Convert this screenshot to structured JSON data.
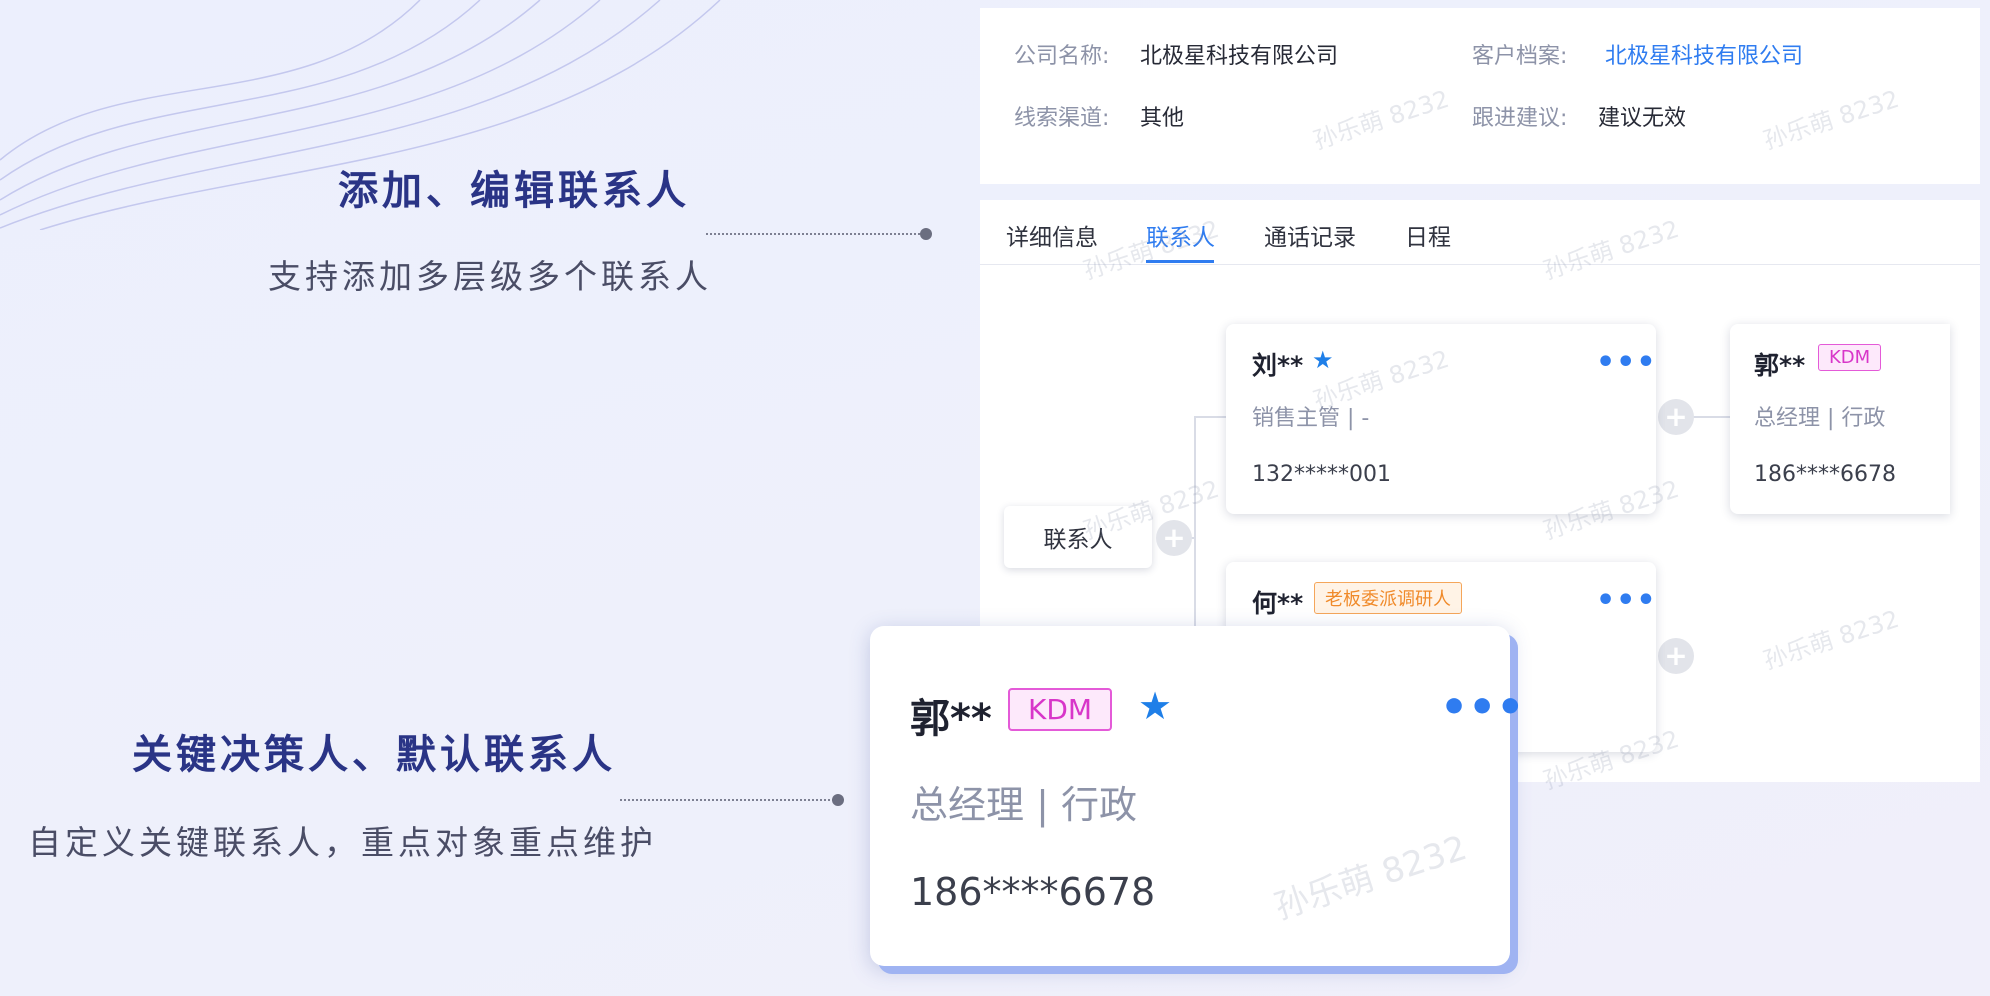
{
  "features": [
    {
      "title": "添加、编辑联系人",
      "subtitle": "支持添加多层级多个联系人"
    },
    {
      "title": "关键决策人、默认联系人",
      "subtitle": "自定义关键联系人，重点对象重点维护"
    }
  ],
  "info": {
    "company_label": "公司名称:",
    "company_value": "北极星科技有限公司",
    "archive_label": "客户档案:",
    "archive_value": "北极星科技有限公司",
    "channel_label": "线索渠道:",
    "channel_value": "其他",
    "advice_label": "跟进建议:",
    "advice_value": "建议无效"
  },
  "tabs": [
    {
      "label": "详细信息",
      "active": false
    },
    {
      "label": "联系人",
      "active": true
    },
    {
      "label": "通话记录",
      "active": false
    },
    {
      "label": "日程",
      "active": false
    }
  ],
  "tree": {
    "root_label": "联系人",
    "cards": [
      {
        "name": "刘**",
        "starred": true,
        "role": "销售主管 | -",
        "phone": "132*****001"
      },
      {
        "name": "郭**",
        "tag": "KDM",
        "role": "总经理 | 行政",
        "phone": "186****6678"
      },
      {
        "name": "何**",
        "tag": "老板委派调研人"
      }
    ]
  },
  "highlight_card": {
    "name": "郭**",
    "tag": "KDM",
    "starred": true,
    "role": "总经理 | 行政",
    "phone": "186****6678"
  },
  "watermark_text": "孙乐萌 8232",
  "colors": {
    "accent": "#2f7cf0",
    "title": "#2a3486",
    "kdm": "#d836c9",
    "boss_tag": "#f08a2a"
  },
  "icons": {
    "star": "star-icon",
    "more": "more-dots-icon",
    "plus": "plus-circle-icon"
  }
}
